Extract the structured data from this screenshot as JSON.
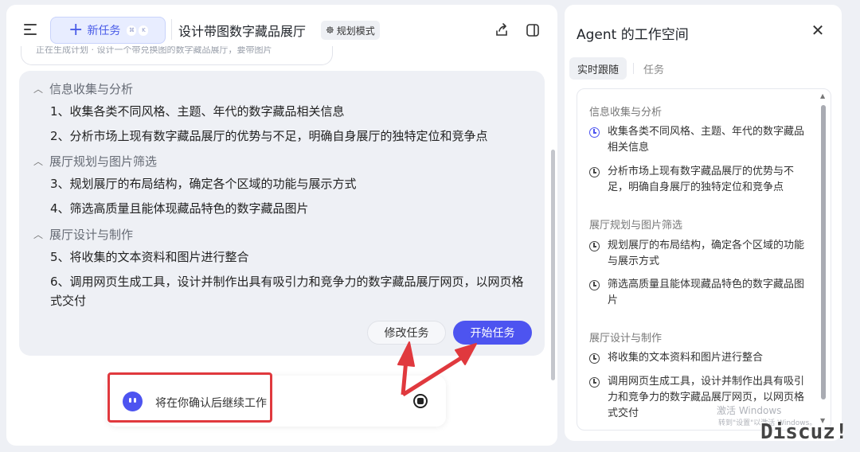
{
  "header": {
    "new_task_label": "新任务",
    "shortcut_keys": [
      "⌘",
      "K"
    ],
    "title": "设计带图数字藏品展厅",
    "mode_badge": "规划模式"
  },
  "status_pill": "正在生成计划 · 设计一个带兑换图的数字藏品展厅，要带图片",
  "plan": {
    "sections": [
      {
        "title": "信息收集与分析",
        "items": [
          "1、收集各类不同风格、主题、年代的数字藏品相关信息",
          "2、分析市场上现有数字藏品展厅的优势与不足，明确自身展厅的独特定位和竞争点"
        ]
      },
      {
        "title": "展厅规划与图片筛选",
        "items": [
          "3、规划展厅的布局结构，确定各个区域的功能与展示方式",
          "4、筛选高质量且能体现藏品特色的数字藏品图片"
        ]
      },
      {
        "title": "展厅设计与制作",
        "items": [
          "5、将收集的文本资料和图片进行整合",
          "6、调用网页生成工具，设计并制作出具有吸引力和竞争力的数字藏品展厅网页，以网页格式交付"
        ]
      }
    ],
    "edit_button": "修改任务",
    "start_button": "开始任务"
  },
  "confirm_text": "将在你确认后继续工作",
  "side": {
    "title": "Agent 的工作空间",
    "tabs": [
      "实时跟随",
      "任务"
    ],
    "sections": [
      {
        "title": "信息收集与分析",
        "items": [
          "收集各类不同风格、主题、年代的数字藏品相关信息",
          "分析市场上现有数字藏品展厅的优势与不足，明确自身展厅的独特定位和竞争点"
        ]
      },
      {
        "title": "展厅规划与图片筛选",
        "items": [
          "规划展厅的布局结构，确定各个区域的功能与展示方式",
          "筛选高质量且能体现藏品特色的数字藏品图片"
        ]
      },
      {
        "title": "展厅设计与制作",
        "items": [
          "将收集的文本资料和图片进行整合",
          "调用网页生成工具，设计并制作出具有吸引力和竞争力的数字藏品展厅网页，以网页格式交付"
        ]
      }
    ]
  },
  "watermark": {
    "line1": "激活 Windows",
    "line2": "转到\"设置\"以激活 Windows。",
    "logo": "Discuz!"
  },
  "colors": {
    "accent": "#4d54f0",
    "annotation_red": "#e0393e",
    "card_bg": "#eef0f5"
  },
  "icons": {
    "menu": "hamburger-icon",
    "new_task": "plus-icon",
    "share": "share-icon",
    "panel": "panel-toggle-icon",
    "close": "close-icon",
    "step": "clock-icon",
    "stop": "stop-icon"
  }
}
